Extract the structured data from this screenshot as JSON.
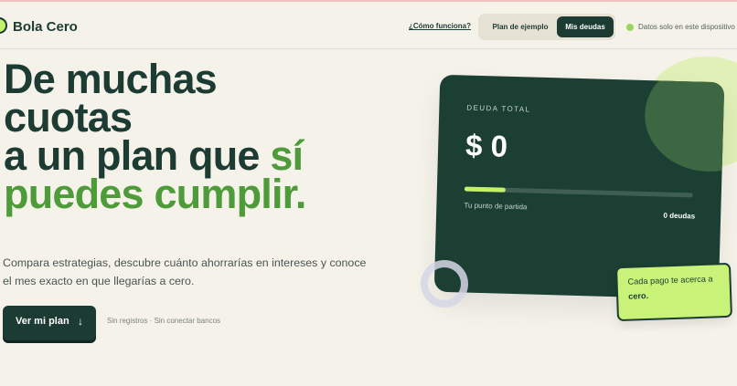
{
  "header": {
    "brand": "Bola Cero",
    "how_link": "¿Cómo funciona?",
    "segment": {
      "example": "Plan de ejemplo",
      "debts": "Mis deudas",
      "selected": "Mis deudas"
    },
    "privacy": "Datos solo en este dispositivo"
  },
  "hero": {
    "line1": "De muchas",
    "line2": "cuotas",
    "line3": "a un plan que",
    "line3_accent": "sí",
    "line4_accent": "puedes cumplir.",
    "lead": "Compara estrategias, descubre cuánto ahorrarías en intereses y conoce el mes exacto en que llegarías a cero.",
    "cta_label": "Ver mi plan",
    "cta_arrow": "↓",
    "cta_note": "Sin registros · Sin conectar bancos"
  },
  "card": {
    "label": "DEUDA TOTAL",
    "amount": "$ 0",
    "progress_fraction": 0.18,
    "start_label": "Tu punto de partida",
    "debt_count": "0 deudas"
  },
  "sticky": {
    "text": "Cada pago te acerca a",
    "bold": "cero."
  },
  "colors": {
    "dark_green": "#1c3b32",
    "accent_green": "#4e9b3a",
    "lime": "#c5f06c",
    "background": "#f5f2ea"
  }
}
